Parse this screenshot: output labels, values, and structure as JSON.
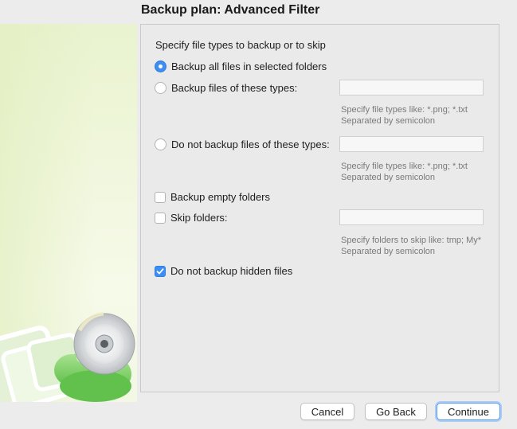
{
  "window": {
    "title": "Backup plan: Advanced Filter"
  },
  "filter": {
    "heading": "Specify file types to backup or to skip",
    "options": [
      {
        "label": "Backup all files in selected folders",
        "selected": true
      },
      {
        "label": "Backup files of these types:",
        "selected": false,
        "value": "",
        "hint1": "Specify file types like: *.png; *.txt",
        "hint2": "Separated by semicolon"
      },
      {
        "label": "Do not backup files of these types:",
        "selected": false,
        "value": "",
        "hint1": "Specify file types like: *.png; *.txt",
        "hint2": "Separated by semicolon"
      }
    ],
    "backup_empty": {
      "label": "Backup empty folders",
      "checked": false
    },
    "skip_folders": {
      "label": "Skip folders:",
      "checked": false,
      "value": "",
      "hint1": "Specify folders to skip like: tmp; My*",
      "hint2": "Separated by semicolon"
    },
    "no_hidden": {
      "label": "Do not backup hidden files",
      "checked": true
    }
  },
  "buttons": {
    "cancel": "Cancel",
    "back": "Go Back",
    "continue": "Continue"
  },
  "colors": {
    "accent": "#3e8ef1",
    "sidebar": "#eef6d8",
    "logo_green": "#7fd26a"
  }
}
